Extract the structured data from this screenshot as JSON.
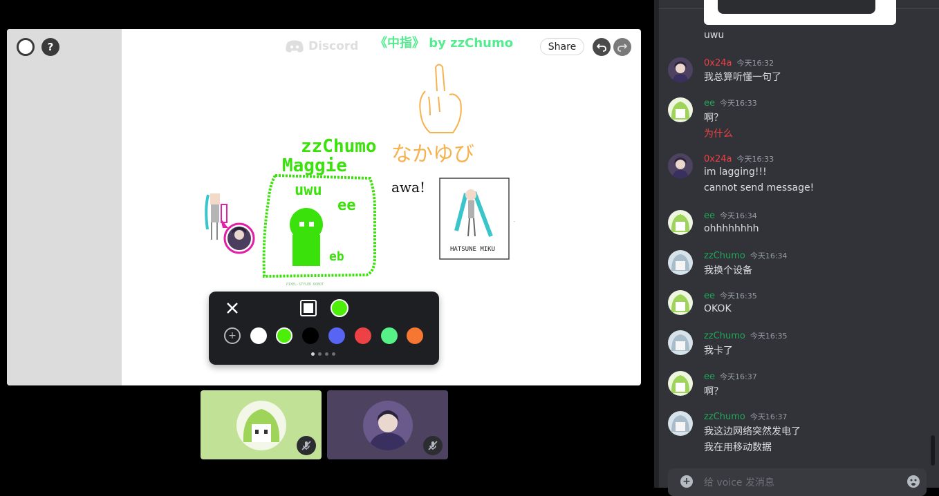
{
  "board": {
    "title": "《中指》 by zzChumo",
    "watermark": "Discord",
    "share_label": "Share",
    "help_label": "?",
    "undo_icon": "undo-icon",
    "redo_icon": "redo-icon",
    "drawing_texts": {
      "zzchumo": "zzChumo",
      "maggie": "Maggie",
      "uwu": "uwu",
      "ee": "ee",
      "eb": "eb",
      "nakayubi": "なかゆび",
      "awa": "awa!",
      "hatsune": "HATSUNE MIKU",
      "pixel_caption": "PIXEL-STYLED ROBOT"
    }
  },
  "palette": {
    "close_icon": "close-icon",
    "colors": [
      "#ffffff",
      "#4cee0a",
      "#000000",
      "#5865f2",
      "#ed4245",
      "#57f287",
      "#f57731"
    ],
    "selected": "#4cee0a",
    "page_indicator": 4,
    "current_page": 1
  },
  "tiles": [
    {
      "user": "ee",
      "muted": true,
      "bg": "#c1e296"
    },
    {
      "user": "0x24a",
      "muted": true,
      "bg": "#4d4360"
    }
  ],
  "chat": {
    "top_message": "uwu",
    "messages": [
      {
        "author": "0x24a",
        "color": "red",
        "time": "今天16:32",
        "lines": [
          "我总算听懂一句了"
        ]
      },
      {
        "author": "ee",
        "color": "green",
        "time": "今天16:33",
        "lines": [
          "啊？"
        ],
        "extra_red": "为什么"
      },
      {
        "author": "0x24a",
        "color": "red",
        "time": "今天16:33",
        "lines": [
          "im lagging!!!",
          "cannot send message!"
        ]
      },
      {
        "author": "ee",
        "color": "green",
        "time": "今天16:34",
        "lines": [
          "ohhhhhhhh"
        ]
      },
      {
        "author": "zzChumo",
        "color": "green",
        "time": "今天16:34",
        "lines": [
          "我换个设备"
        ]
      },
      {
        "author": "ee",
        "color": "green",
        "time": "今天16:35",
        "lines": [
          "OKOK"
        ]
      },
      {
        "author": "zzChumo",
        "color": "green",
        "time": "今天16:35",
        "lines": [
          "我卡了"
        ]
      },
      {
        "author": "ee",
        "color": "green",
        "time": "今天16:37",
        "lines": [
          "啊？"
        ]
      },
      {
        "author": "zzChumo",
        "color": "green",
        "time": "今天16:37",
        "lines": [
          "我这边网络突然发电了",
          "我在用移动数据"
        ]
      }
    ],
    "composer_placeholder": "给 voice 发消息"
  }
}
